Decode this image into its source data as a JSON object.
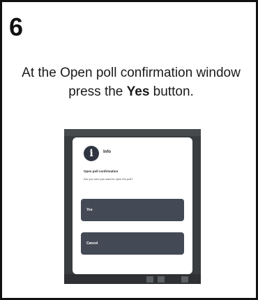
{
  "step": {
    "number": "6"
  },
  "instruction": {
    "before": "At the Open poll confirmation window press the ",
    "emphasis": "Yes",
    "after": " button."
  },
  "dialog": {
    "icon": "info-icon",
    "icon_glyph": "i",
    "title": "Info",
    "heading": "Open poll confirmation",
    "question": "Are you sure you want to open the poll?",
    "yes_label": "Yes",
    "cancel_label": "Cancel"
  },
  "colors": {
    "border": "#111111",
    "button": "#434a56",
    "backdrop": "#3a3d40"
  }
}
